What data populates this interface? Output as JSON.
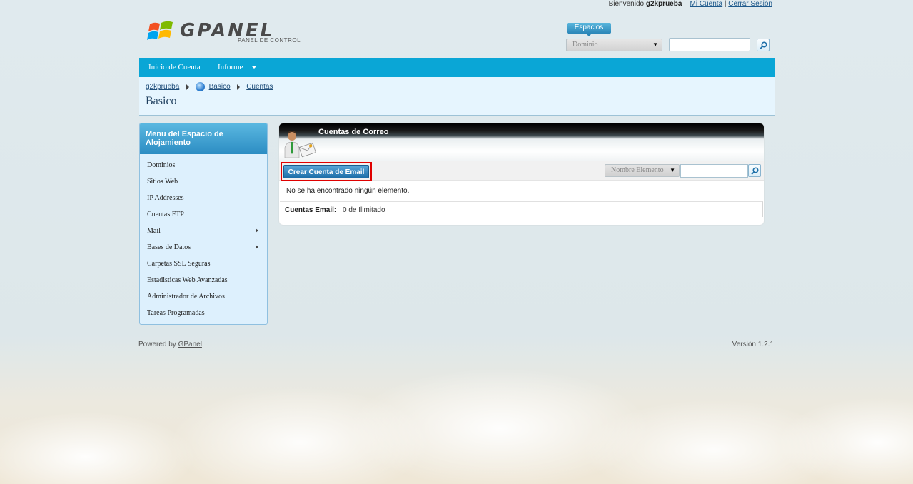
{
  "userbar": {
    "welcome": "Bienvenido",
    "username": "g2kprueba",
    "my_account": "Mi Cuenta",
    "separator": "|",
    "logout": "Cerrar Sesión"
  },
  "logo": {
    "wordmark": "GPANEL",
    "tagline": "PANEL DE CONTROL"
  },
  "spaces": {
    "tab_label": "Espacios",
    "domain_select": "Dominio",
    "search_value": "",
    "search_icon": "magnifier-icon"
  },
  "nav": {
    "items": [
      {
        "label": "Inicio de Cuenta"
      },
      {
        "label": "Informe",
        "has_dropdown": true
      }
    ]
  },
  "breadcrumb": {
    "items": [
      "g2kprueba",
      "Basico",
      "Cuentas"
    ],
    "title": "Basico"
  },
  "sidebar": {
    "title": "Menu del Espacio de Alojamiento",
    "items": [
      {
        "label": "Dominios"
      },
      {
        "label": "Sitios Web"
      },
      {
        "label": "IP Addresses"
      },
      {
        "label": "Cuentas FTP"
      },
      {
        "label": "Mail",
        "has_submenu": true
      },
      {
        "label": "Bases de Datos",
        "has_submenu": true
      },
      {
        "label": "Carpetas SSL Seguras"
      },
      {
        "label": "Estadisticas Web Avanzadas"
      },
      {
        "label": "Administrador de Archivos"
      },
      {
        "label": "Tareas Programadas"
      }
    ]
  },
  "panel": {
    "title": "Cuentas de Correo",
    "create_button": "Crear Cuenta de Email",
    "filter_select": "Nombre Elemento",
    "filter_value": "",
    "empty_message": "No se ha encontrado ningún elemento.",
    "summary_label": "Cuentas Email:",
    "summary_value": "0 de Ilimitado"
  },
  "footer": {
    "powered_by": "Powered by",
    "powered_link": "GPanel",
    "powered_dot": ".",
    "version": "Versión 1.2.1"
  },
  "colors": {
    "nav_bar": "#0aa6d6",
    "highlight_border": "#e00000",
    "link": "#1f5a8c"
  }
}
